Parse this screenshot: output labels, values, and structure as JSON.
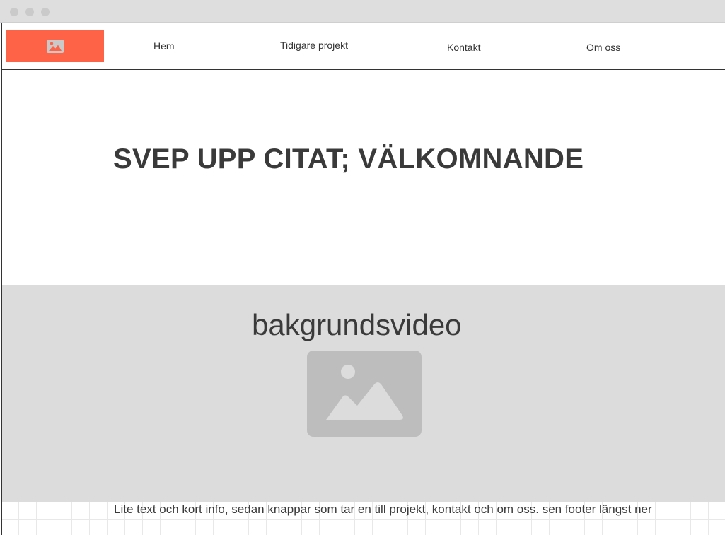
{
  "nav": {
    "logo_icon": "image-icon",
    "items": [
      {
        "label": "Hem"
      },
      {
        "label": "Tidigare projekt"
      },
      {
        "label": "Kontakt"
      },
      {
        "label": "Om oss"
      }
    ]
  },
  "hero": {
    "title": "SVEP UPP CITAT; VÄLKOMNANDE"
  },
  "video": {
    "label": "bakgrundsvideo",
    "placeholder_icon": "image-icon"
  },
  "info": {
    "text": "Lite text och kort info, sedan knappar som tar en till projekt, kontakt och om oss. sen footer längst ner"
  },
  "colors": {
    "logo_background": "#ff6347",
    "video_background": "#dcdcdc",
    "placeholder": "#bdbdbd",
    "text": "#3a3a3a"
  }
}
